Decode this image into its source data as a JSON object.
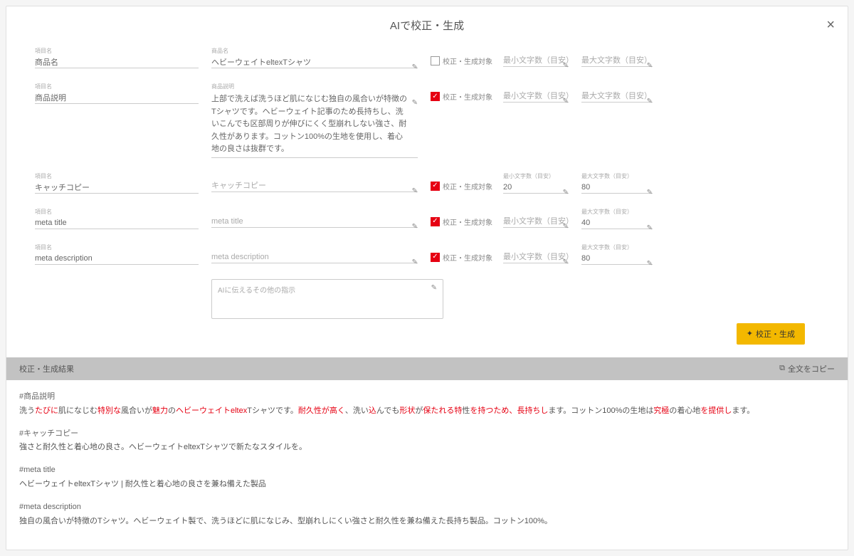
{
  "modal": {
    "title": "AIで校正・生成",
    "close": "×"
  },
  "labels": {
    "itemNameTiny": "項目名",
    "productNameTiny": "商品名",
    "productDescTiny": "商品説明",
    "minCharsTiny": "最小文字数（目安）",
    "maxCharsTiny": "最大文字数（目安）",
    "checkLabel": "校正・生成対象"
  },
  "rows": [
    {
      "label": "商品名",
      "valueLabel": "商品名",
      "value": "ヘビーウェイトeltexTシャツ",
      "checked": false,
      "minPlaceholder": "最小文字数（目安）",
      "min": "",
      "maxPlaceholder": "最大文字数（目安）",
      "max": ""
    },
    {
      "label": "商品説明",
      "valueLabel": "商品説明",
      "value": "上部で洗えば洗うほど肌になじむ独自の風合いが特徴のTシャツです。ヘビーウェイト記事のため長持ちし、洗いこんでも区部周りが伸びにくく型崩れしない強さ、耐久性があります。コットン100%の生地を使用し、着心地の良さは抜群です。",
      "checked": true,
      "multiline": true,
      "minPlaceholder": "最小文字数（目安）",
      "min": "",
      "maxPlaceholder": "最大文字数（目安）",
      "max": ""
    },
    {
      "label": "キャッチコピー",
      "valueLabel": "",
      "valuePlaceholder": "キャッチコピー",
      "value": "",
      "checked": true,
      "minPlaceholder": "最小文字数（目安）",
      "min": "20",
      "maxPlaceholder": "最大文字数（目安）",
      "max": "80"
    },
    {
      "label": "meta title",
      "valueLabel": "",
      "valuePlaceholder": "meta title",
      "value": "",
      "checked": true,
      "minPlaceholder": "最小文字数（目安）",
      "min": "",
      "maxPlaceholder": "最大文字数（目安）",
      "max": "40"
    },
    {
      "label": "meta description",
      "valueLabel": "",
      "valuePlaceholder": "meta description",
      "value": "",
      "checked": true,
      "minPlaceholder": "最小文字数（目安）",
      "min": "",
      "maxPlaceholder": "最大文字数（目安）",
      "max": "80"
    }
  ],
  "extraInstruction": {
    "placeholder": "AIに伝えるその他の指示"
  },
  "generateButton": "校正・生成",
  "resultsBar": {
    "title": "校正・生成結果",
    "copyAll": "全文をコピー"
  },
  "results": {
    "desc": {
      "heading": "#商品説明",
      "parts": [
        {
          "t": "洗う",
          "hl": false
        },
        {
          "t": "たびに",
          "hl": true
        },
        {
          "t": "肌になじむ",
          "hl": false
        },
        {
          "t": "特別な",
          "hl": true
        },
        {
          "t": "風合いが",
          "hl": false
        },
        {
          "t": "魅力",
          "hl": true
        },
        {
          "t": "の",
          "hl": false
        },
        {
          "t": "ヘビーウェイトeltex",
          "hl": true
        },
        {
          "t": "Tシャツです。",
          "hl": false
        },
        {
          "t": "耐久性が高く",
          "hl": true
        },
        {
          "t": "、洗い",
          "hl": false
        },
        {
          "t": "込",
          "hl": true
        },
        {
          "t": "んでも",
          "hl": false
        },
        {
          "t": "形状",
          "hl": true
        },
        {
          "t": "が",
          "hl": false
        },
        {
          "t": "保たれる特",
          "hl": true
        },
        {
          "t": "性",
          "hl": false
        },
        {
          "t": "を持つため、長持ちし",
          "hl": true
        },
        {
          "t": "ます。コットン100%の生地は",
          "hl": false
        },
        {
          "t": "究極",
          "hl": true
        },
        {
          "t": "の着心地",
          "hl": false
        },
        {
          "t": "を提供し",
          "hl": true
        },
        {
          "t": "ます。",
          "hl": false
        }
      ]
    },
    "catch": {
      "heading": "#キャッチコピー",
      "text": "強さと耐久性と着心地の良さ。ヘビーウェイトeltexTシャツで新たなスタイルを。"
    },
    "metaTitle": {
      "heading": "#meta title",
      "text": "ヘビーウェイトeltexTシャツ | 耐久性と着心地の良さを兼ね備えた製品"
    },
    "metaDesc": {
      "heading": "#meta description",
      "text": "独自の風合いが特徴のTシャツ。ヘビーウェイト製で、洗うほどに肌になじみ、型崩れしにくい強さと耐久性を兼ね備えた長持ち製品。コットン100%。"
    }
  }
}
